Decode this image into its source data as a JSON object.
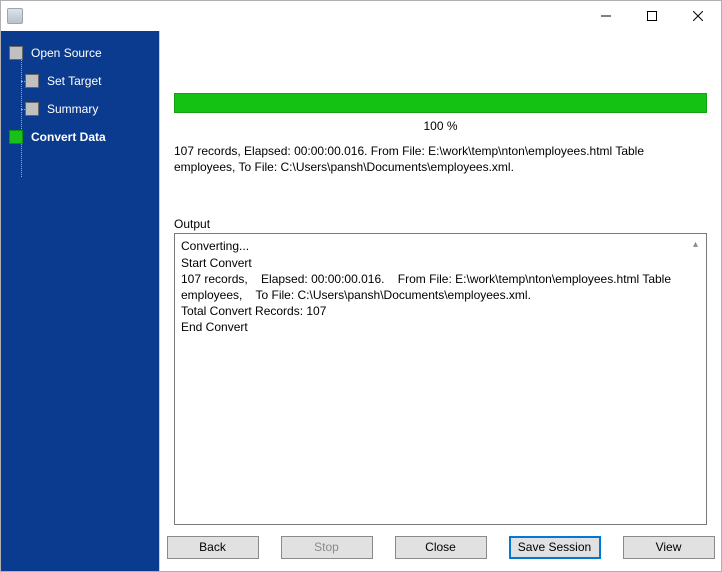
{
  "window": {
    "title": ""
  },
  "sidebar": {
    "items": [
      {
        "label": "Open Source"
      },
      {
        "label": "Set Target"
      },
      {
        "label": "Summary"
      },
      {
        "label": "Convert Data"
      }
    ]
  },
  "progress": {
    "percent_label": "100 %",
    "fill_pct": "100%"
  },
  "status": {
    "line": "107 records,    Elapsed: 00:00:00.016.    From File: E:\\work\\temp\\nton\\employees.html Table employees,    To File: C:\\Users\\pansh\\Documents\\employees.xml."
  },
  "output": {
    "label": "Output",
    "text": "Converting...\nStart Convert\n107 records,    Elapsed: 00:00:00.016.    From File: E:\\work\\temp\\nton\\employees.html Table employees,    To File: C:\\Users\\pansh\\Documents\\employees.xml.\nTotal Convert Records: 107\nEnd Convert"
  },
  "buttons": {
    "back": "Back",
    "stop": "Stop",
    "close": "Close",
    "save_session": "Save Session",
    "view": "View"
  }
}
